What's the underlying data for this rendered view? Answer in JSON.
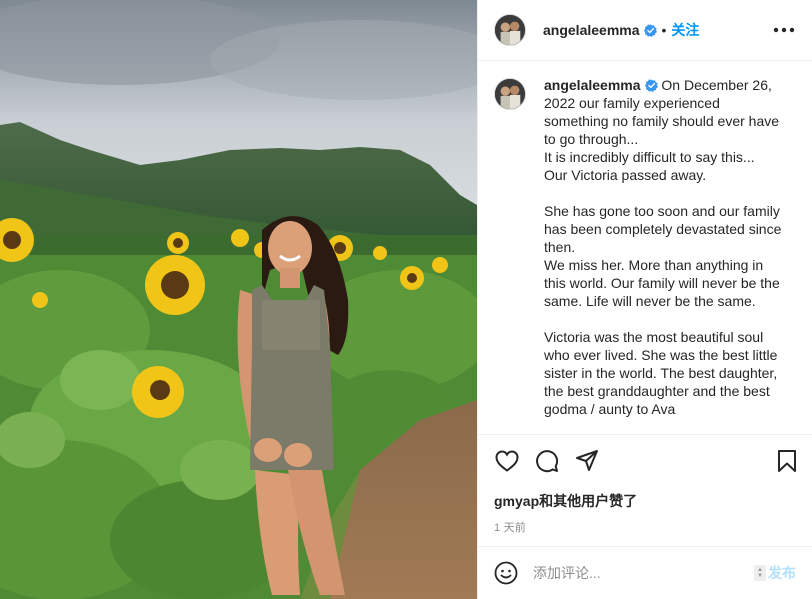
{
  "post": {
    "username": "angelaleemma",
    "follow_label": "关注",
    "dot": "•",
    "caption": "On December 26, 2022 our family experienced something no family should ever have to go through...\nIt is incredibly difficult to say this...\nOur Victoria passed away.\n\nShe has gone too soon and our family has been completely devastated since then.\nWe miss her. More than anything in this world. Our family will never be the same. Life will never be the same.\n\nVictoria was the most beautiful soul who ever lived. She was the best little sister in the world. The best daughter, the best granddaughter and the best godma / aunty to Ava",
    "likes_text": "gmyap和其他用户赞了",
    "time_text": "1 天前",
    "comment_placeholder": "添加评论...",
    "post_label": "发布"
  },
  "icons": {
    "verified": "verified-badge-icon",
    "more": "more-options-icon",
    "like": "heart-icon",
    "comment": "comment-icon",
    "share": "share-icon",
    "save": "bookmark-icon",
    "emoji": "emoji-icon"
  },
  "colors": {
    "accent": "#0095f6",
    "verified": "#3897f0",
    "muted": "#8e8e8e",
    "post_disabled": "#b2dffc"
  }
}
